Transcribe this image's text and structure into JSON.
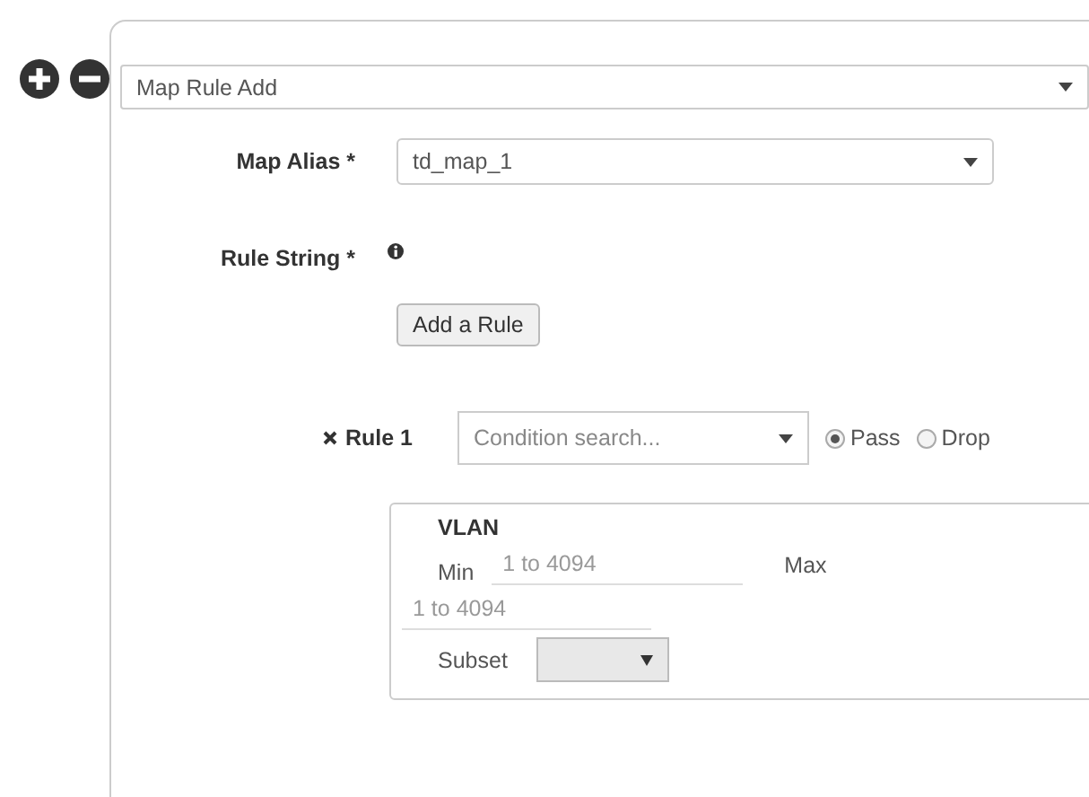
{
  "header_select": {
    "value": "Map Rule Add"
  },
  "map_alias": {
    "label": "Map Alias *",
    "value": "td_map_1"
  },
  "rule_string": {
    "label": "Rule String *"
  },
  "add_rule_button": "Add a Rule",
  "rules": [
    {
      "label": "Rule 1",
      "condition": {
        "placeholder": "Condition search..."
      },
      "actions": [
        {
          "label": "Pass",
          "selected": true
        },
        {
          "label": "Drop",
          "selected": false
        }
      ],
      "conditions": [
        {
          "title": "VLAN",
          "min_label": "Min",
          "min_placeholder": "1 to 4094",
          "max_label": "Max",
          "max_placeholder": "1 to 4094",
          "subset_label": "Subset"
        }
      ]
    }
  ]
}
